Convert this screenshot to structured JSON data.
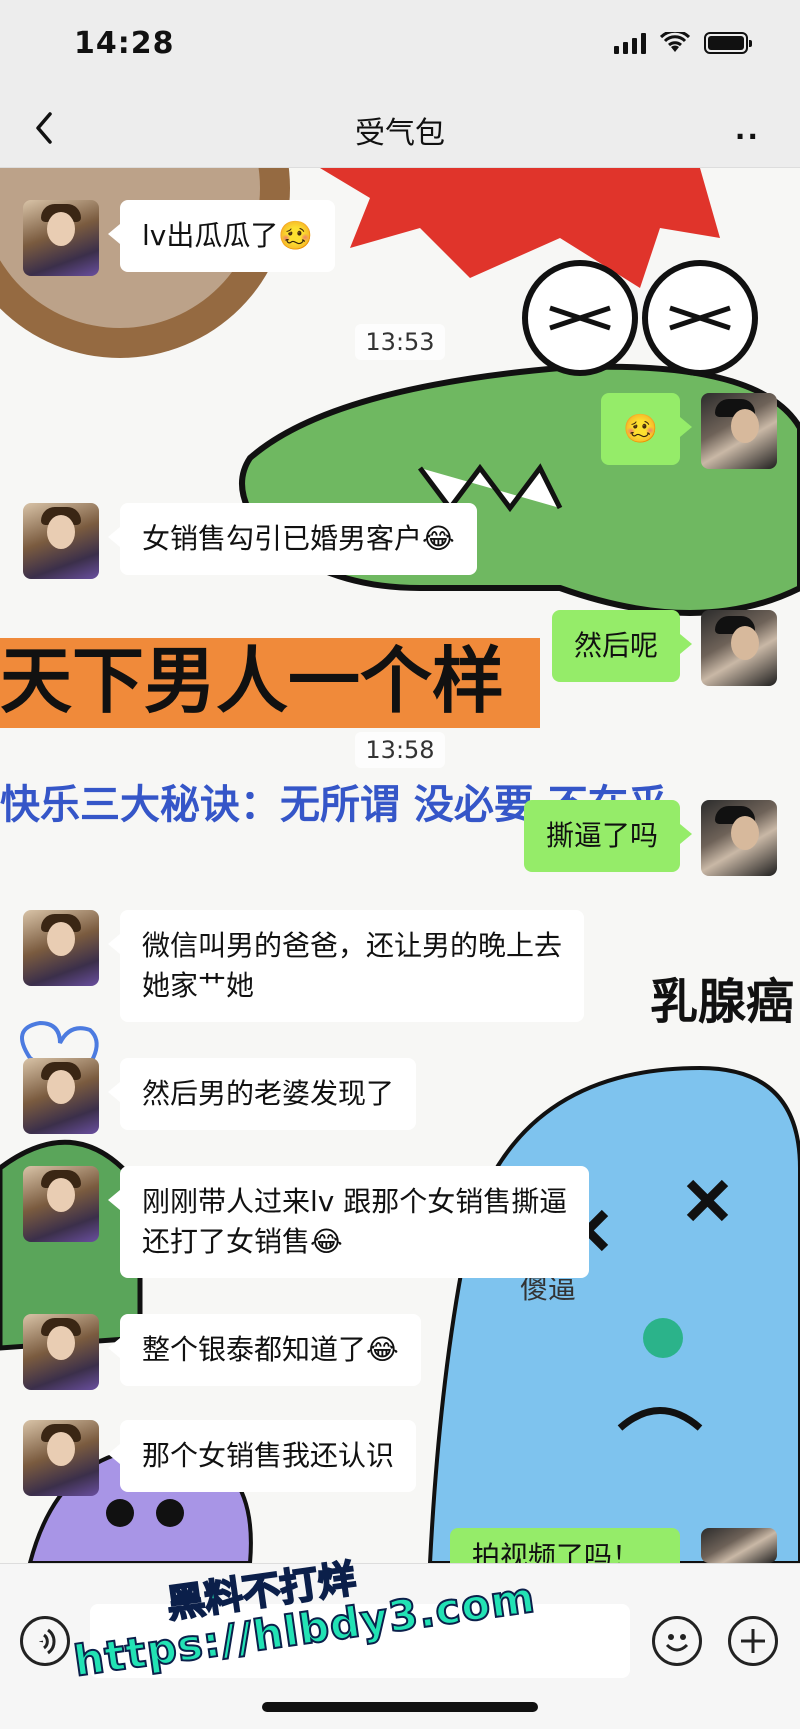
{
  "status_bar": {
    "time": "14:28"
  },
  "header": {
    "title": "受气包",
    "more": "··"
  },
  "messages": [
    {
      "side": "left",
      "text": "lv出瓜瓜了🥴"
    },
    {
      "timestamp": "13:53"
    },
    {
      "side": "right",
      "text": "🥴"
    },
    {
      "side": "left",
      "text": "女销售勾引已婚男客户😂"
    },
    {
      "side": "right",
      "text": "然后呢"
    },
    {
      "timestamp": "13:58"
    },
    {
      "side": "right",
      "text": "撕逼了吗"
    },
    {
      "side": "left",
      "text": "微信叫男的爸爸，还让男的晚上去\n她家艹她"
    },
    {
      "side": "left",
      "text": "然后男的老婆发现了"
    },
    {
      "side": "left",
      "text": "刚刚带人过来lv 跟那个女销售撕逼\n还打了女销售😂"
    },
    {
      "side": "left",
      "text": "整个银泰都知道了😂"
    },
    {
      "side": "left",
      "text": "那个女销售我还认识"
    },
    {
      "side": "right",
      "text": "拍视频了吗！"
    }
  ],
  "background_text": {
    "sticker_1": "天下男人一个样",
    "sticker_2": "快乐三大秘诀：无所谓 没必要 不在乎",
    "sticker_3": "乳腺癌",
    "sticker_4": "傻逼"
  },
  "watermark": {
    "line1": "黑料不打烊",
    "line2": "https://hlbdy3.com"
  },
  "colors": {
    "bubble_self": "#95ec69",
    "bubble_other": "#ffffff",
    "chat_bg": "#f7f7f5",
    "header_bg": "#ededed"
  }
}
